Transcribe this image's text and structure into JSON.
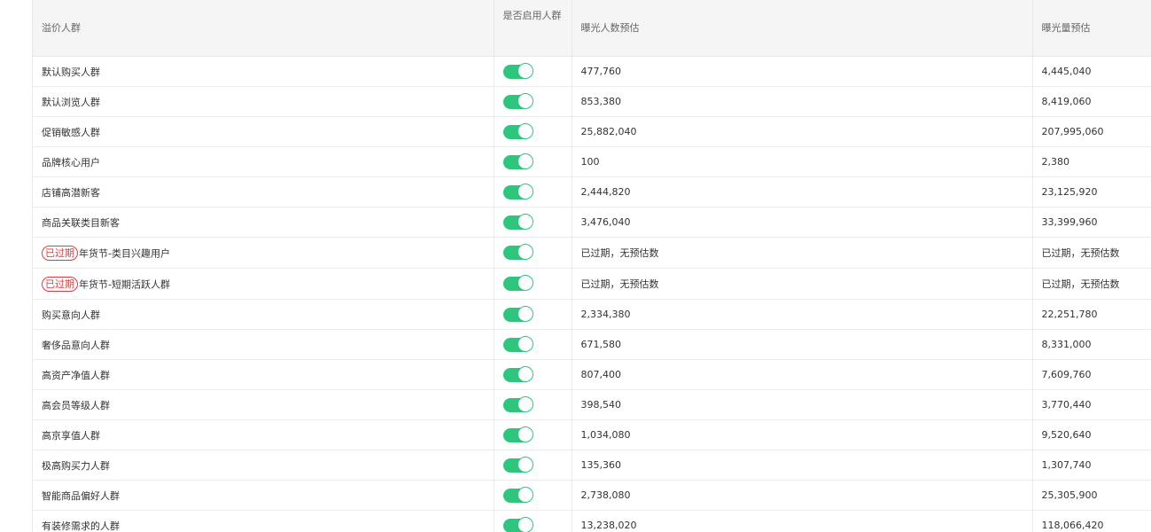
{
  "colors": {
    "toggle_on": "#2ec67d",
    "expired_badge": "#e4393c",
    "header_bg": "#f5f5f5"
  },
  "table": {
    "headers": {
      "segment": "溢价人群",
      "enabled": "是否启用人群",
      "reach_people": "曝光人数预估",
      "reach_volume": "曝光量预估"
    },
    "rows": [
      {
        "badge": "",
        "name": "默认购买人群",
        "enabled": true,
        "people": "477,760",
        "volume": "4,445,040"
      },
      {
        "badge": "",
        "name": "默认浏览人群",
        "enabled": true,
        "people": "853,380",
        "volume": "8,419,060"
      },
      {
        "badge": "",
        "name": "促销敏感人群",
        "enabled": true,
        "people": "25,882,040",
        "volume": "207,995,060"
      },
      {
        "badge": "",
        "name": "品牌核心用户",
        "enabled": true,
        "people": "100",
        "volume": "2,380"
      },
      {
        "badge": "",
        "name": "店铺高潜新客",
        "enabled": true,
        "people": "2,444,820",
        "volume": "23,125,920"
      },
      {
        "badge": "",
        "name": "商品关联类目新客",
        "enabled": true,
        "people": "3,476,040",
        "volume": "33,399,960"
      },
      {
        "badge": "已过期",
        "name": "年货节-类目兴趣用户",
        "enabled": true,
        "people": "已过期，无预估数",
        "volume": "已过期，无预估数"
      },
      {
        "badge": "已过期",
        "name": "年货节-短期活跃人群",
        "enabled": true,
        "people": "已过期，无预估数",
        "volume": "已过期，无预估数"
      },
      {
        "badge": "",
        "name": "购买意向人群",
        "enabled": true,
        "people": "2,334,380",
        "volume": "22,251,780"
      },
      {
        "badge": "",
        "name": "奢侈品意向人群",
        "enabled": true,
        "people": "671,580",
        "volume": "8,331,000"
      },
      {
        "badge": "",
        "name": "高资产净值人群",
        "enabled": true,
        "people": "807,400",
        "volume": "7,609,760"
      },
      {
        "badge": "",
        "name": "高会员等级人群",
        "enabled": true,
        "people": "398,540",
        "volume": "3,770,440"
      },
      {
        "badge": "",
        "name": "高京享值人群",
        "enabled": true,
        "people": "1,034,080",
        "volume": "9,520,640"
      },
      {
        "badge": "",
        "name": "极高购买力人群",
        "enabled": true,
        "people": "135,360",
        "volume": "1,307,740"
      },
      {
        "badge": "",
        "name": "智能商品偏好人群",
        "enabled": true,
        "people": "2,738,080",
        "volume": "25,305,900"
      },
      {
        "badge": "",
        "name": "有装修需求的人群",
        "enabled": true,
        "people": "13,238,020",
        "volume": "118,066,420"
      }
    ]
  }
}
